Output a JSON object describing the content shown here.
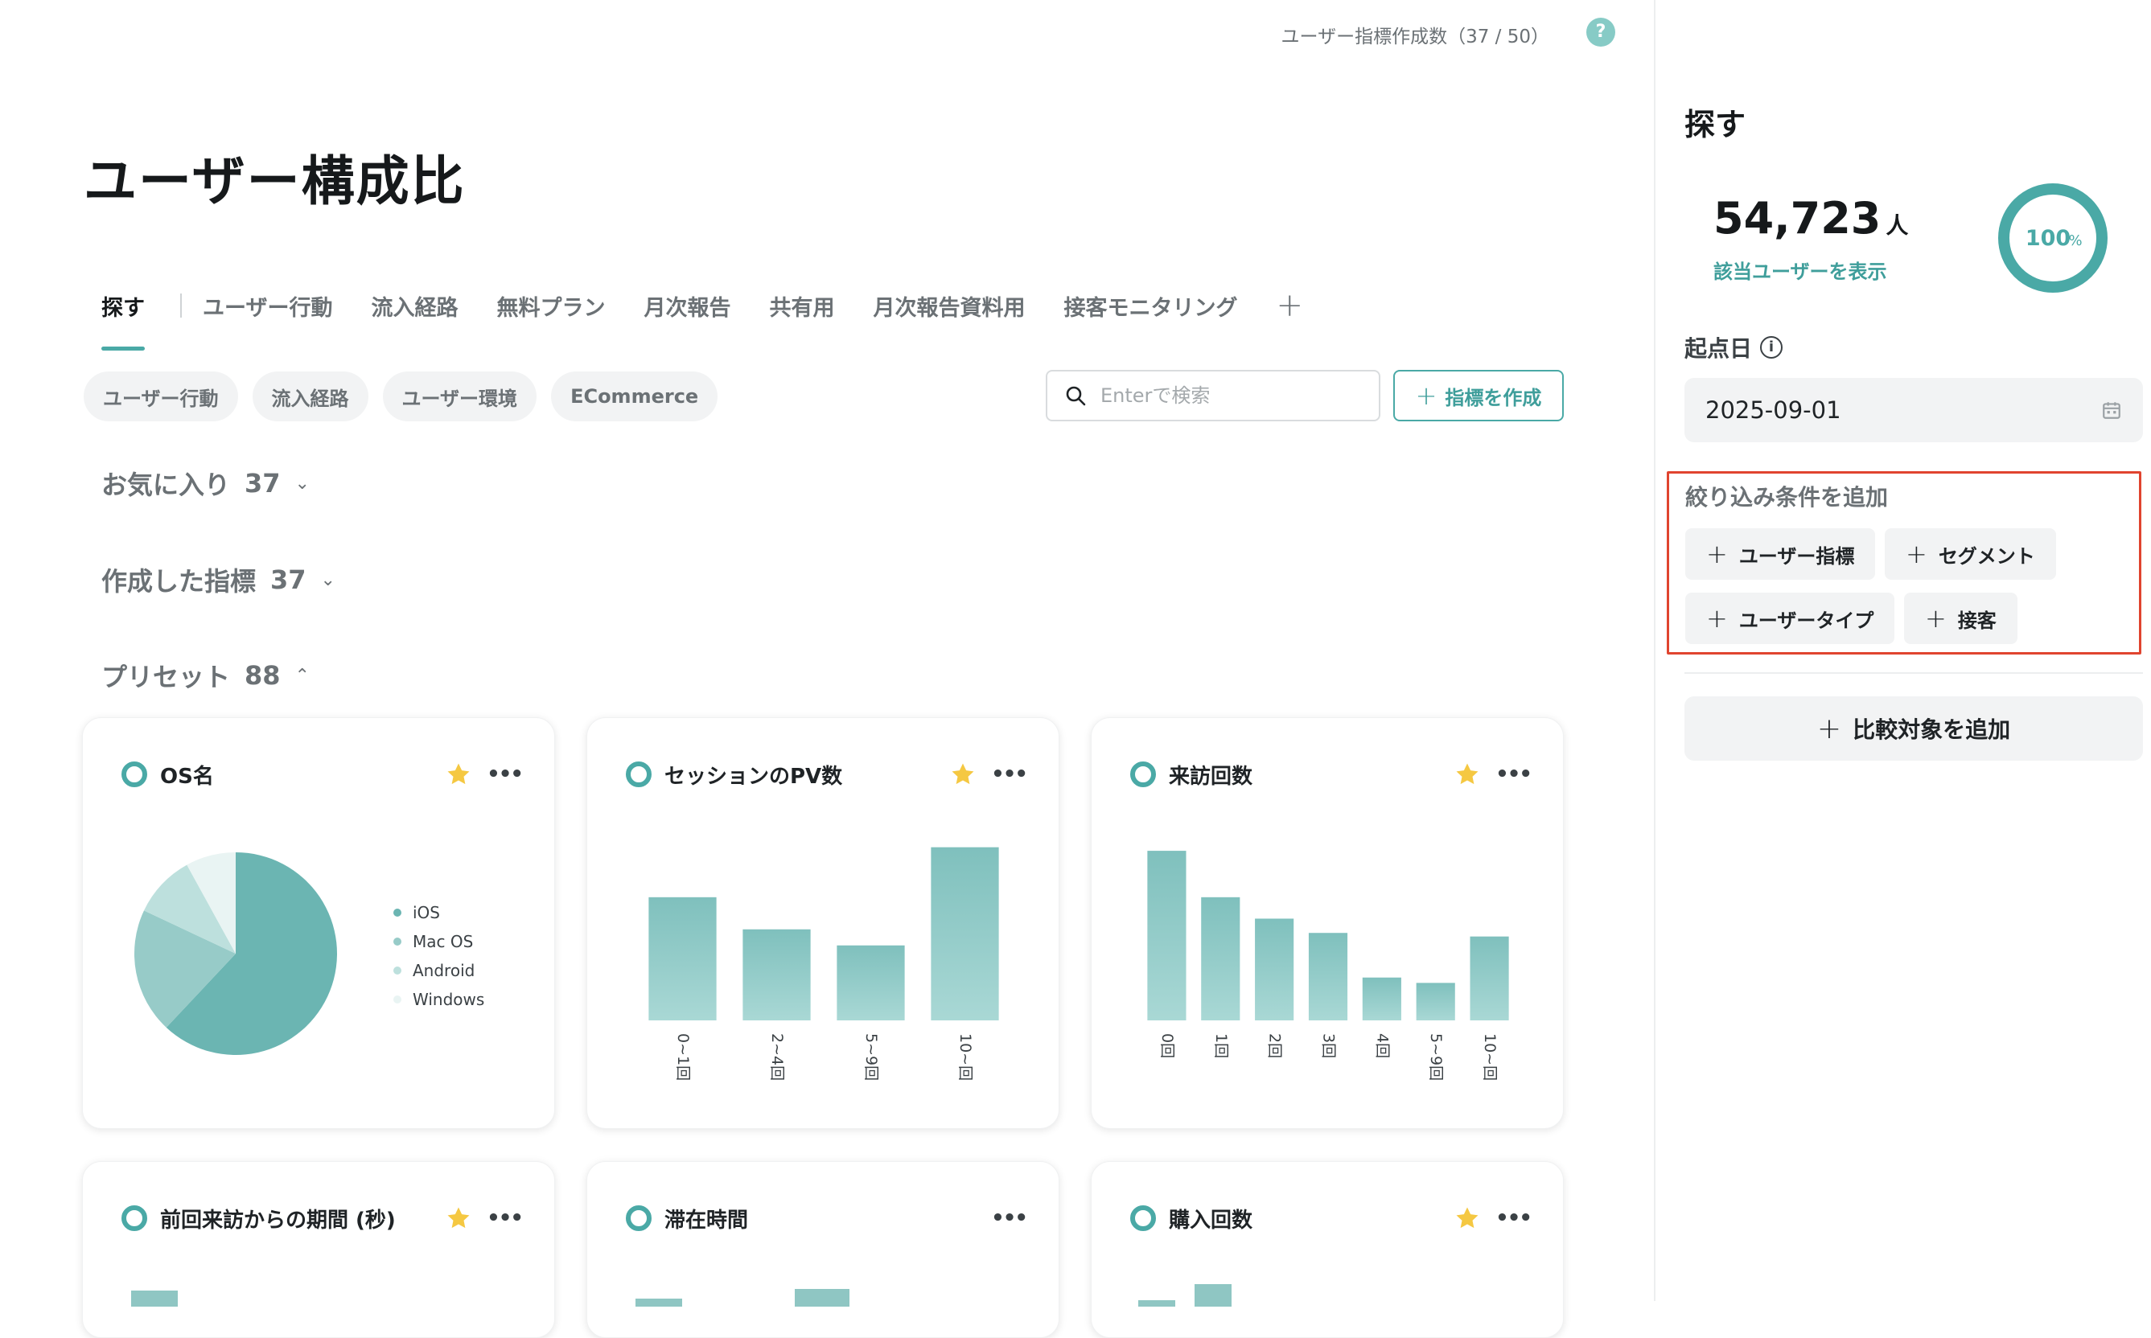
{
  "header": {
    "quota_text": "ユーザー指標作成数（37 / 50）",
    "help_icon": "help-icon"
  },
  "page": {
    "title": "ユーザー構成比"
  },
  "tabs": [
    {
      "label": "探す",
      "active": true
    },
    {
      "label": "ユーザー行動"
    },
    {
      "label": "流入経路"
    },
    {
      "label": "無料プラン"
    },
    {
      "label": "月次報告"
    },
    {
      "label": "共有用"
    },
    {
      "label": "月次報告資料用"
    },
    {
      "label": "接客モニタリング"
    }
  ],
  "tab_add": "+",
  "chips": [
    {
      "label": "ユーザー行動"
    },
    {
      "label": "流入経路"
    },
    {
      "label": "ユーザー環境"
    },
    {
      "label": "ECommerce"
    }
  ],
  "search": {
    "placeholder": "Enterで検索"
  },
  "create_button": {
    "label": "指標を作成"
  },
  "sections": {
    "favorites": {
      "label": "お気に入り",
      "count": "37"
    },
    "created": {
      "label": "作成した指標",
      "count": "37"
    },
    "preset": {
      "label": "プリセット",
      "count": "88"
    }
  },
  "colors": {
    "accent": "#4aa9a6",
    "bar_top": "#7fc0bd",
    "bar_bottom": "#a9d8d5",
    "star": "#f5c842",
    "highlight_border": "#e0442f"
  },
  "cards": [
    {
      "title": "OS名",
      "starred": true
    },
    {
      "title": "セッションのPV数",
      "starred": true
    },
    {
      "title": "来訪回数",
      "starred": true
    },
    {
      "title": "前回来訪からの期間 (秒)",
      "starred": true
    },
    {
      "title": "滞在時間",
      "starred": false
    },
    {
      "title": "購入回数",
      "starred": true
    }
  ],
  "chart_data": [
    {
      "type": "pie",
      "categories": [
        "iOS",
        "Mac OS",
        "Android",
        "Windows"
      ],
      "values": [
        62,
        20,
        10,
        8
      ],
      "colors": [
        "#6bb5b2",
        "#97cbc8",
        "#bde0dd",
        "#e9f4f3"
      ]
    },
    {
      "type": "bar",
      "categories": [
        "0~1回",
        "2~4回",
        "5~9回",
        "10~回"
      ],
      "values": [
        69,
        51,
        42,
        97
      ],
      "ylim": [
        0,
        100
      ]
    },
    {
      "type": "bar",
      "categories": [
        "0回",
        "1回",
        "2回",
        "3回",
        "4回",
        "5~9回",
        "10~回"
      ],
      "values": [
        95,
        69,
        57,
        49,
        24,
        21,
        47
      ],
      "ylim": [
        0,
        100
      ]
    }
  ],
  "side": {
    "title": "探す",
    "count": "54,723",
    "count_unit": "人",
    "show_users": "該当ユーザーを表示",
    "percent": "100",
    "percent_unit": "%",
    "base_date_label": "起点日",
    "base_date": "2025-09-01",
    "filter_title": "絞り込み条件を追加",
    "filter_buttons": [
      {
        "label": "ユーザー指標"
      },
      {
        "label": "セグメント"
      },
      {
        "label": "ユーザータイプ"
      },
      {
        "label": "接客"
      }
    ],
    "compare_label": "比較対象を追加"
  }
}
